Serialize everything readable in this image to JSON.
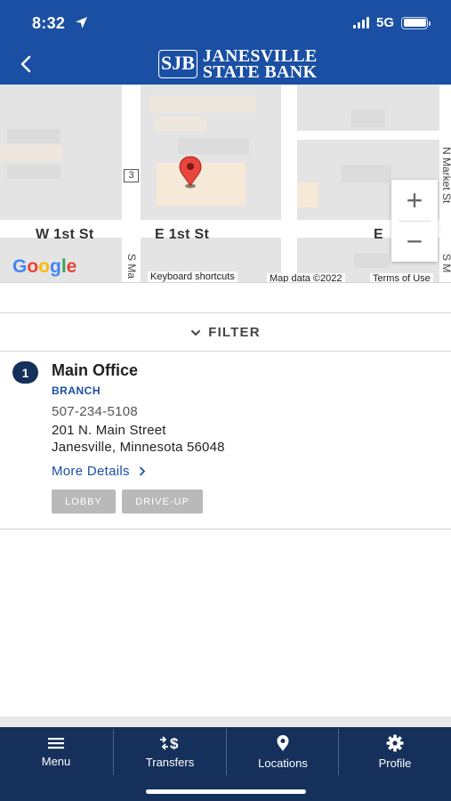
{
  "status_bar": {
    "time": "8:32",
    "network": "5G"
  },
  "header": {
    "logo_mark": "SJB",
    "logo_line1": "JANESVILLE",
    "logo_line2": "STATE BANK"
  },
  "map": {
    "streets": {
      "w_1st": "W 1st St",
      "e_1st": "E 1st St",
      "e_cut": "E",
      "s_main": "S Ma",
      "n_market": "N Market St",
      "s_right": "S M"
    },
    "route_number": "3",
    "zoom_in": "+",
    "zoom_out": "−",
    "google_letters": [
      "G",
      "o",
      "o",
      "g",
      "l",
      "e"
    ],
    "keyboard_shortcuts": "Keyboard shortcuts",
    "map_data": "Map data ©2022",
    "terms": "Terms of Use"
  },
  "filter": {
    "label": "FILTER"
  },
  "location": {
    "number": "1",
    "name": "Main Office",
    "type": "BRANCH",
    "phone": "507-234-5108",
    "address_line1": "201 N. Main Street",
    "address_line2": "Janesville, Minnesota 56048",
    "more_details": "More Details",
    "tags": [
      "LOBBY",
      "DRIVE-UP"
    ]
  },
  "nav": {
    "items": [
      {
        "label": "Menu",
        "icon": "menu-icon"
      },
      {
        "label": "Transfers",
        "icon": "transfers-icon"
      },
      {
        "label": "Locations",
        "icon": "location-pin-icon"
      },
      {
        "label": "Profile",
        "icon": "gear-icon"
      }
    ]
  },
  "colors": {
    "header": "#1a4fa3",
    "nav": "#15305b",
    "link": "#1a4fa3",
    "tag": "#b9b9b9",
    "pin": "#e8453c",
    "google_blue": "#4285F4",
    "google_red": "#EA4335",
    "google_yellow": "#FBBC05",
    "google_green": "#34A853"
  }
}
